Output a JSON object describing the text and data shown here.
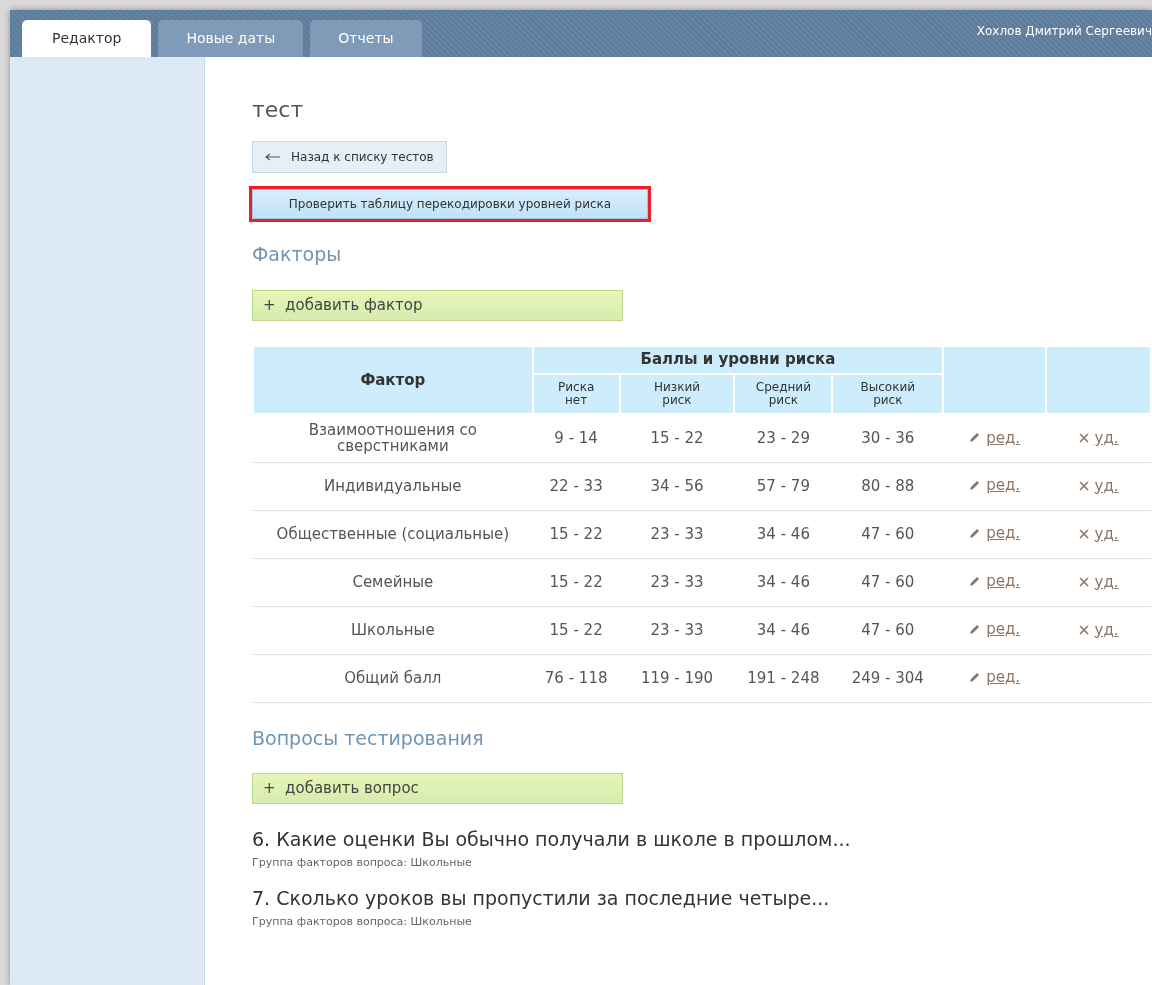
{
  "tabs": [
    {
      "label": "Редактор",
      "selected": true
    },
    {
      "label": "Новые даты",
      "selected": false
    },
    {
      "label": "Отчеты",
      "selected": false
    }
  ],
  "user_name": "Хохлов Дмитрий Сергеевич",
  "page_title": "тест",
  "back_button": {
    "label": "Назад к списку тестов"
  },
  "check_button": {
    "label": "Проверить таблицу перекодировки уровней риска",
    "highlighted": true
  },
  "factors": {
    "heading": "Факторы",
    "add_button": {
      "symbol": "+",
      "label": "добавить фактор"
    },
    "table": {
      "columns": {
        "factor": "Фактор",
        "group": "Баллы и уровни риска",
        "levels": [
          [
            "Риска",
            "нет"
          ],
          [
            "Низкий",
            "риск"
          ],
          [
            "Средний",
            "риск"
          ],
          [
            "Высокий",
            "риск"
          ]
        ]
      },
      "rows": [
        {
          "factor": "Взаимоотношения со сверстниками",
          "scores": [
            "9 - 14",
            "15 - 22",
            "23 - 29",
            "30 - 36"
          ],
          "edit": "ред.",
          "delete": "уд."
        },
        {
          "factor": "Индивидуальные",
          "scores": [
            "22 - 33",
            "34 - 56",
            "57 - 79",
            "80 - 88"
          ],
          "edit": "ред.",
          "delete": "уд."
        },
        {
          "factor": "Общественные (социальные)",
          "scores": [
            "15 - 22",
            "23 - 33",
            "34 - 46",
            "47 - 60"
          ],
          "edit": "ред.",
          "delete": "уд."
        },
        {
          "factor": "Семейные",
          "scores": [
            "15 - 22",
            "23 - 33",
            "34 - 46",
            "47 - 60"
          ],
          "edit": "ред.",
          "delete": "уд."
        },
        {
          "factor": "Школьные",
          "scores": [
            "15 - 22",
            "23 - 33",
            "34 - 46",
            "47 - 60"
          ],
          "edit": "ред.",
          "delete": "уд."
        },
        {
          "factor": "Общий балл",
          "scores": [
            "76 - 118",
            "119 - 190",
            "191 - 248",
            "249 - 304"
          ],
          "edit": "ред."
        }
      ]
    }
  },
  "questions": {
    "heading": "Вопросы тестирования",
    "add_button": {
      "symbol": "+",
      "label": "добавить вопрос"
    },
    "items": [
      {
        "title": "6. Какие оценки Вы обычно получали в школе в прошлом...",
        "group": "Группа факторов вопроса: Школьные"
      },
      {
        "title": "7. Сколько уроков вы пропустили за последние четыре...",
        "group": "Группа факторов вопроса: Школьные"
      }
    ]
  }
}
